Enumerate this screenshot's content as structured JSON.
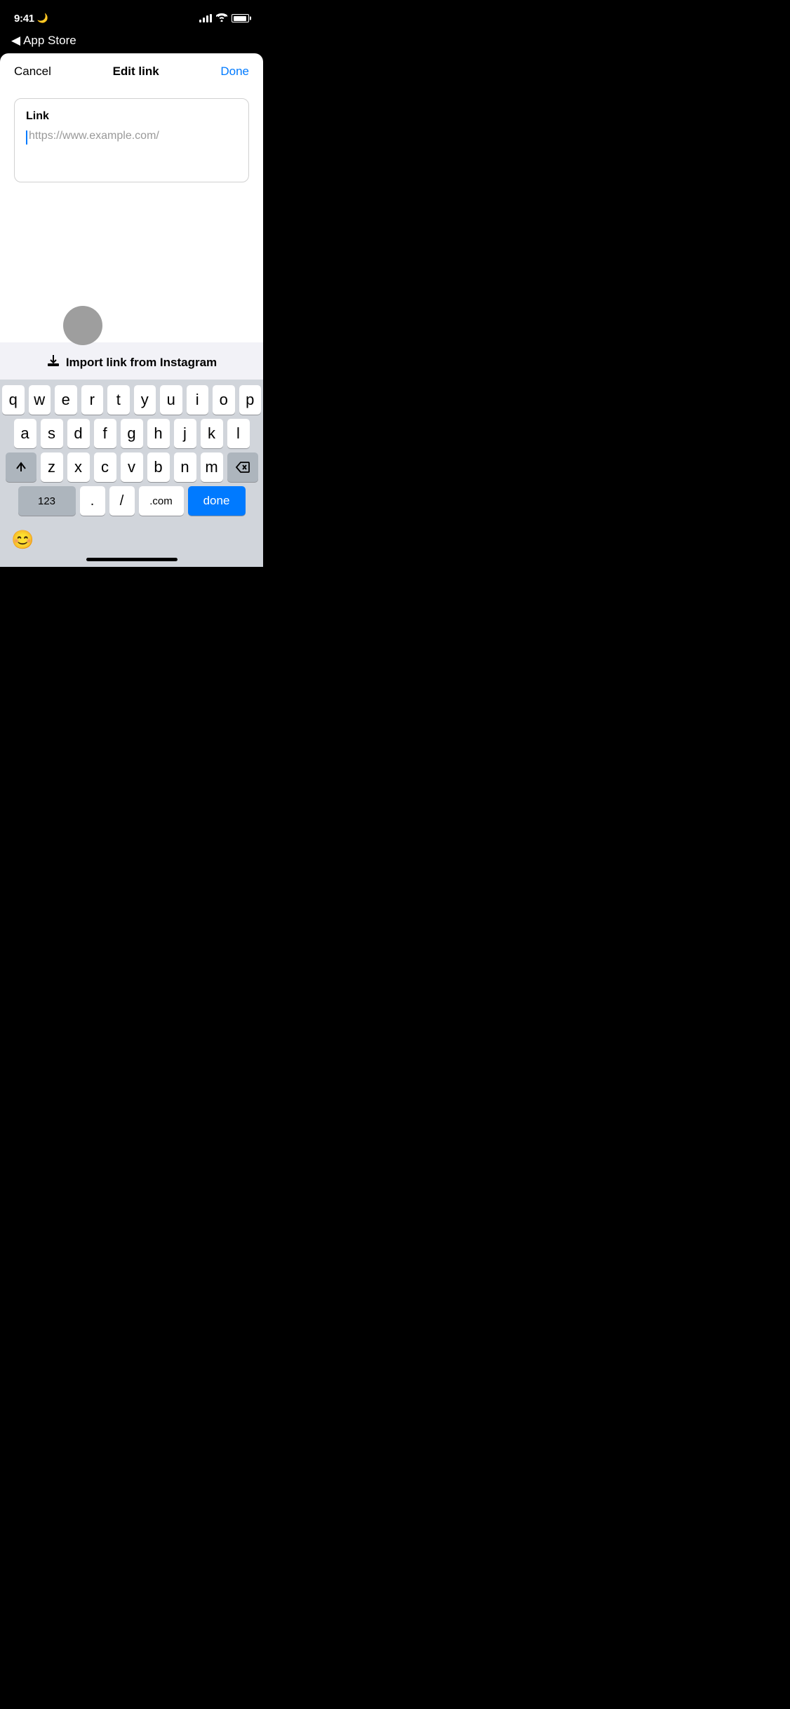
{
  "status": {
    "time": "9:41",
    "moon_icon": "🌙"
  },
  "nav": {
    "back_arrow": "◀",
    "back_label": "App Store"
  },
  "header": {
    "cancel_label": "Cancel",
    "title": "Edit link",
    "done_label": "Done"
  },
  "link_box": {
    "link_label": "Link",
    "placeholder": "https://www.example.com/"
  },
  "import": {
    "icon": "⬆",
    "label": "Import link from Instagram"
  },
  "keyboard": {
    "row1": [
      "q",
      "w",
      "e",
      "r",
      "t",
      "y",
      "u",
      "i",
      "o",
      "p"
    ],
    "row2": [
      "a",
      "s",
      "d",
      "f",
      "g",
      "h",
      "j",
      "k",
      "l"
    ],
    "row3": [
      "z",
      "x",
      "c",
      "v",
      "b",
      "n",
      "m"
    ],
    "bottom_left": "123",
    "dot": ".",
    "slash": "/",
    "dot_com": ".com",
    "done": "done",
    "emoji": "😊"
  }
}
